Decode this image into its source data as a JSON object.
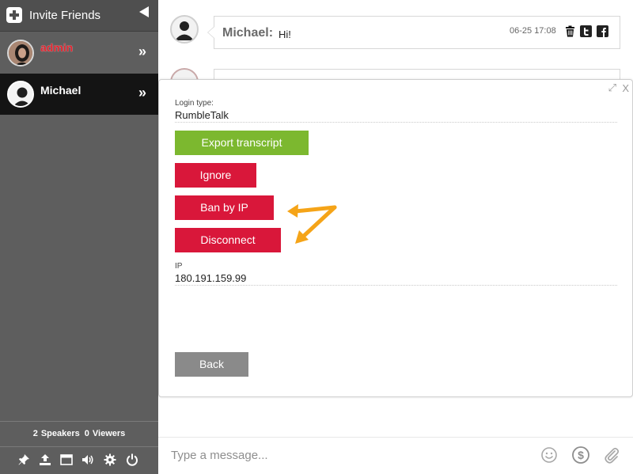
{
  "sidebar": {
    "invite_label": "Invite Friends",
    "users": [
      {
        "name": "admin",
        "chevron": "»"
      },
      {
        "name": "Michael",
        "chevron": "»"
      }
    ],
    "stats": {
      "speakers_count": "2",
      "speakers_label": "Speakers",
      "viewers_count": "0",
      "viewers_label": "Viewers"
    },
    "tools": [
      "pin-icon",
      "upload-icon",
      "window-icon",
      "speaker-icon",
      "gear-icon",
      "power-icon"
    ]
  },
  "messages": [
    {
      "sender": "Michael:",
      "text": "Hi!",
      "time": "06-25 17:08",
      "actions": [
        "trash-icon",
        "twitter-icon",
        "facebook-icon"
      ]
    }
  ],
  "panel": {
    "expand_glyph": "⤢",
    "close_glyph": "X",
    "login_type_label": "Login type:",
    "login_type_value": "RumbleTalk",
    "buttons": {
      "export": "Export transcript",
      "ignore": "Ignore",
      "ban": "Ban by IP",
      "disconnect": "Disconnect",
      "back": "Back"
    },
    "ip_label": "IP",
    "ip_value": "180.191.159.99"
  },
  "composer": {
    "placeholder": "Type a message...",
    "icons": [
      "emoji-icon",
      "dollar-icon",
      "paperclip-icon"
    ]
  },
  "colors": {
    "sidebar_bg": "#5e5e5e",
    "selected_user_bg": "#141414",
    "admin_name": "#e0232e",
    "export_button": "#7cb82f",
    "danger_button": "#d9173a",
    "back_button": "#8a8a8a",
    "annotation_arrow": "#f5a418"
  }
}
